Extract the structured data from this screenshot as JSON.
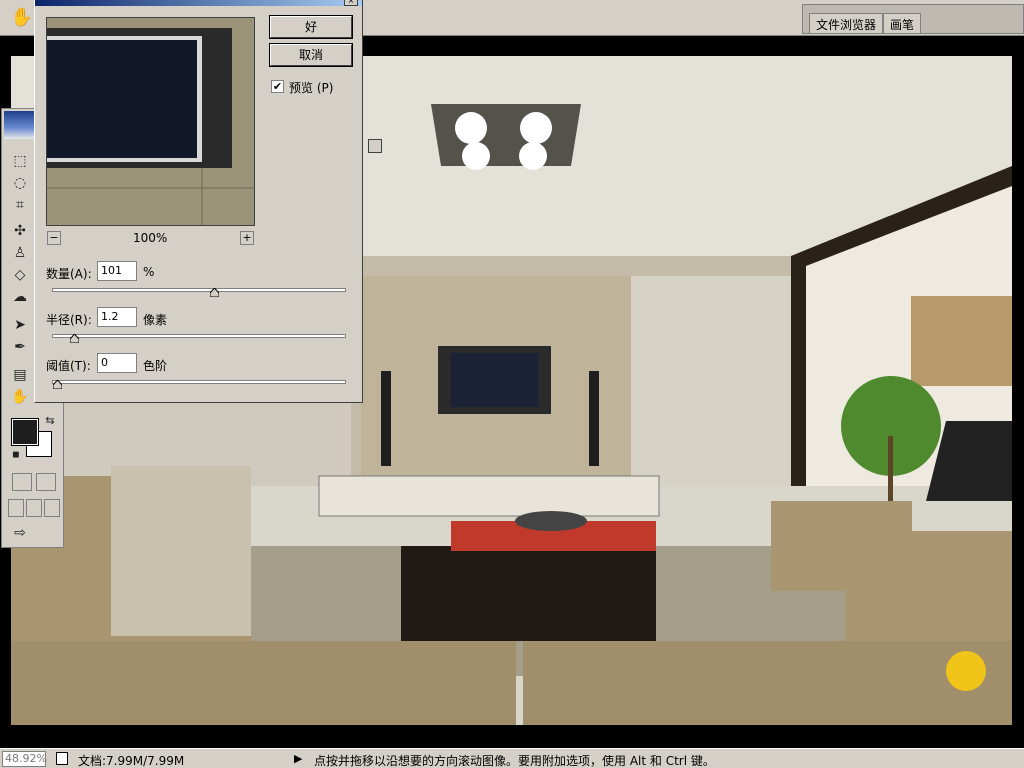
{
  "options_bar": {
    "hand_icon": "hand-icon",
    "palette_tabs": [
      "文件浏览器",
      "画笔"
    ]
  },
  "toolbox": {
    "tools": [
      "marquee-icon",
      "lasso-icon",
      "crop-icon",
      "healing-icon",
      "stamp-icon",
      "eraser-icon",
      "blur-icon",
      "move-arrow-icon",
      "pen-icon",
      "notes-icon",
      "hand-icon"
    ],
    "foreground_color": "#1e1e1e",
    "background_color": "#ffffff"
  },
  "dialog": {
    "ok_label": "好",
    "cancel_label": "取消",
    "preview_checked": true,
    "preview_label": "预览 (P)",
    "zoom_minus": "−",
    "zoom_plus": "+",
    "zoom_percent": "100%",
    "amount_label": "数量(A):",
    "amount_value": "101",
    "amount_unit": "%",
    "amount_slider": 0.55,
    "radius_label": "半径(R):",
    "radius_value": "1.2",
    "radius_unit": "像素",
    "radius_slider": 0.06,
    "threshold_label": "阈值(T):",
    "threshold_value": "0",
    "threshold_unit": "色阶",
    "threshold_slider": 0.0
  },
  "status_bar": {
    "zoom": "48.92%",
    "doc_size": "文档:7.99M/7.99M",
    "arrow": "▶",
    "message": "点按并拖移以沿想要的方向滚动图像。要用附加选项，使用 Alt 和 Ctrl 键。"
  },
  "colors": {
    "chrome": "#d4d0c8",
    "title_bar": "#0a246a",
    "wall": "#d8d3c6",
    "sofa": "#a99570"
  }
}
